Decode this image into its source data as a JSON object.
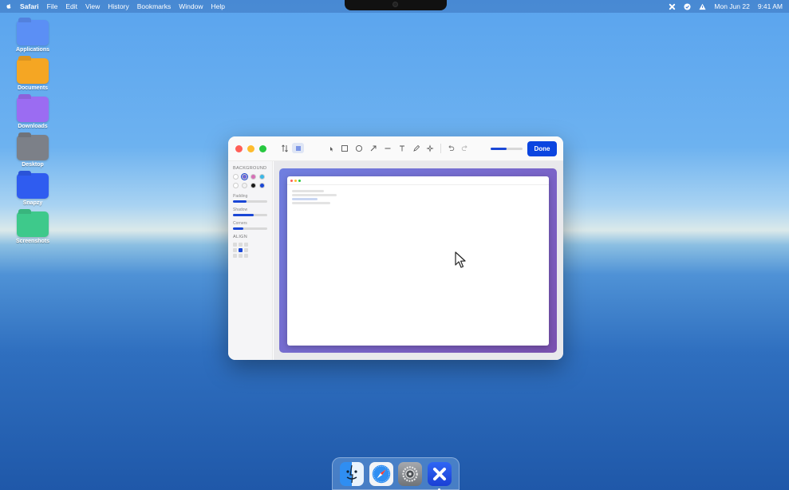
{
  "menubar": {
    "app_name": "Safari",
    "items": [
      "File",
      "Edit",
      "View",
      "History",
      "Bookmarks",
      "Window",
      "Help"
    ],
    "date": "Mon Jun 22",
    "time": "9:41 AM",
    "status_icons": [
      "snapzy-icon",
      "checkmark-circle-icon",
      "warning-icon"
    ]
  },
  "desktop": {
    "folders": [
      {
        "label": "Applications",
        "color": "#5b8ff5"
      },
      {
        "label": "Documents",
        "color": "#f5a623"
      },
      {
        "label": "Downloads",
        "color": "#9b6cf2"
      },
      {
        "label": "Desktop",
        "color": "#7c8088"
      },
      {
        "label": "Snapzy",
        "color": "#2f5cf0"
      },
      {
        "label": "Screenshots",
        "color": "#3ec98b"
      }
    ]
  },
  "editor": {
    "done_label": "Done",
    "zoom_level": 0.5,
    "sidebar": {
      "background_title": "BACKGROUND",
      "swatch_colors": [
        "#ffffff",
        "#6f66d8",
        "#d86fb8",
        "#3ab8e8",
        "#ffffff",
        "#f2f2f2",
        "#1a1a1a",
        "#1a47d6"
      ],
      "selected_swatch": 1,
      "sliders": [
        {
          "label": "Padding",
          "value": 0.4
        },
        {
          "label": "Shadow",
          "value": 0.6
        },
        {
          "label": "Corners",
          "value": 0.3
        }
      ],
      "align_title": "ALIGN",
      "align_selected": 4
    }
  },
  "dock": {
    "apps": [
      "finder-icon",
      "safari-icon",
      "system-settings-icon",
      "snapzy-icon"
    ],
    "running_app": 3
  }
}
